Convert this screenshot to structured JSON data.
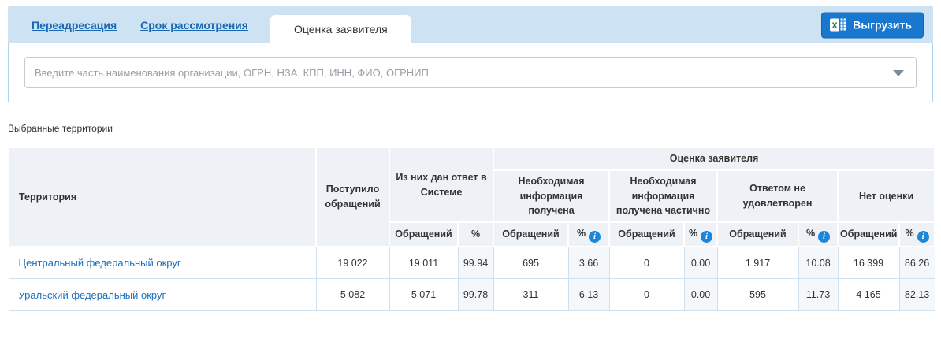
{
  "tabs": [
    {
      "label": "Переадресация",
      "active": false
    },
    {
      "label": "Срок рассмотрения",
      "active": false
    },
    {
      "label": "Оценка заявителя",
      "active": true
    }
  ],
  "export_button": {
    "label": "Выгрузить",
    "icon": "excel-icon"
  },
  "search": {
    "placeholder": "Введите часть наименования организации, ОГРН, НЗА, КПП, ИНН, ФИО, ОГРНИП"
  },
  "selected_territories_label": "Выбранные территории",
  "icons": {
    "info_glyph": "i",
    "chevron": "chevron-down"
  },
  "colors": {
    "tab_bar": "#cde3f3",
    "panel_border": "#aed2eb",
    "accent_link": "#1a70c0",
    "button_blue": "#1878d0",
    "header_bg": "#eef2f7",
    "pct_col_bg": "#f5f8fb",
    "info_icon_bg": "#1e86d9",
    "row_border": "#cfe0ef"
  },
  "table": {
    "headers": {
      "territory": "Территория",
      "received": "Поступило обращений",
      "answered_group": "Из них дан ответ в Системе",
      "evaluation_group": "Оценка заявителя",
      "groups": [
        "Необходимая информация получена",
        "Необходимая информация получена частично",
        "Ответом не удовлетворен",
        "Нет оценки"
      ],
      "sub_appeals": "Обращений",
      "sub_percent": "%"
    },
    "rows": [
      {
        "territory": "Центральный федеральный округ",
        "values": [
          "19 022",
          "19 011",
          "99.94",
          "695",
          "3.66",
          "0",
          "0.00",
          "1 917",
          "10.08",
          "16 399",
          "86.26"
        ]
      },
      {
        "territory": "Уральский федеральный округ",
        "values": [
          "5 082",
          "5 071",
          "99.78",
          "311",
          "6.13",
          "0",
          "0.00",
          "595",
          "11.73",
          "4 165",
          "82.13"
        ]
      }
    ]
  }
}
